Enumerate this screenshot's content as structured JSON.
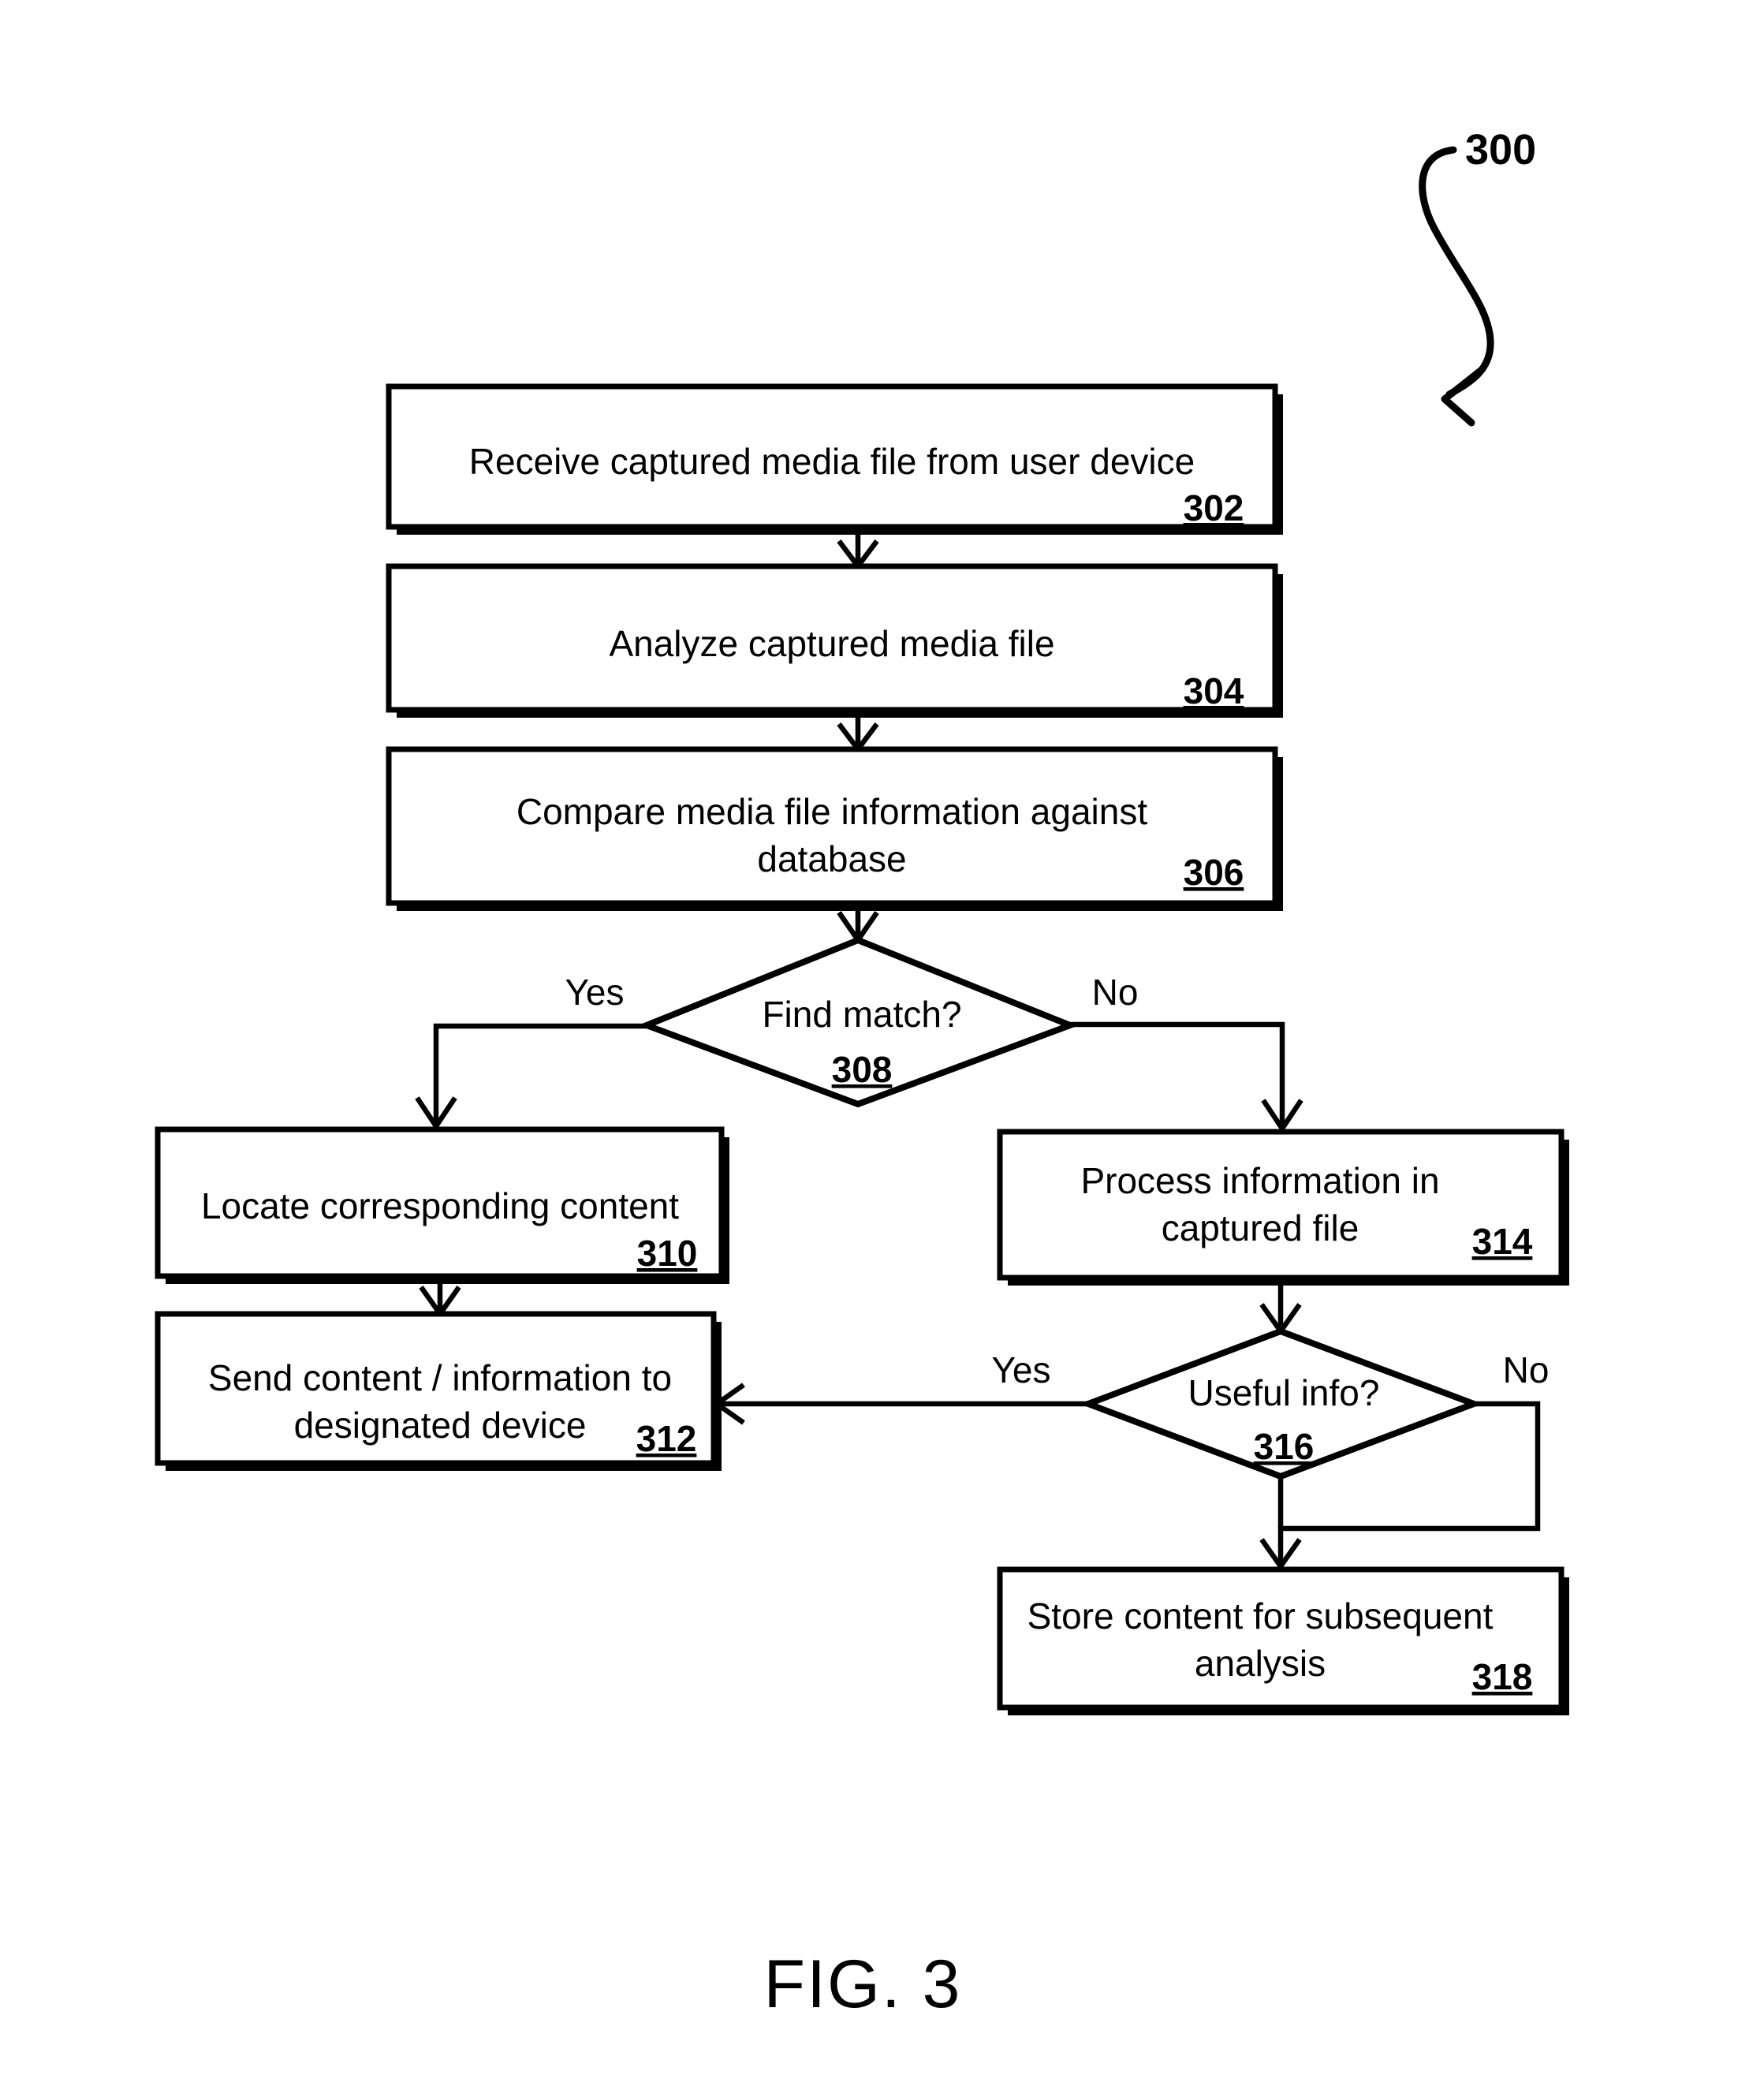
{
  "figure": {
    "caption": "FIG. 3",
    "reference_numeral": "300"
  },
  "diagram": {
    "type": "flowchart",
    "nodes": [
      {
        "id": "302",
        "shape": "process",
        "lines": [
          "Receive captured media file from user device"
        ],
        "ref": "302"
      },
      {
        "id": "304",
        "shape": "process",
        "lines": [
          "Analyze captured media file"
        ],
        "ref": "304"
      },
      {
        "id": "306",
        "shape": "process",
        "lines": [
          "Compare media file information against",
          "database"
        ],
        "ref": "306"
      },
      {
        "id": "308",
        "shape": "decision",
        "lines": [
          "Find match?"
        ],
        "ref": "308"
      },
      {
        "id": "310",
        "shape": "process",
        "lines": [
          "Locate corresponding content"
        ],
        "ref": "310"
      },
      {
        "id": "312",
        "shape": "process",
        "lines": [
          "Send content / information to",
          "designated device"
        ],
        "ref": "312"
      },
      {
        "id": "314",
        "shape": "process",
        "lines": [
          "Process information in",
          "captured file"
        ],
        "ref": "314"
      },
      {
        "id": "316",
        "shape": "decision",
        "lines": [
          "Useful info?"
        ],
        "ref": "316"
      },
      {
        "id": "318",
        "shape": "process",
        "lines": [
          "Store content for subsequent",
          "analysis"
        ],
        "ref": "318"
      }
    ],
    "edges": [
      {
        "from": "302",
        "to": "304",
        "label": ""
      },
      {
        "from": "304",
        "to": "306",
        "label": ""
      },
      {
        "from": "306",
        "to": "308",
        "label": ""
      },
      {
        "from": "308",
        "to": "310",
        "label": "Yes"
      },
      {
        "from": "308",
        "to": "314",
        "label": "No"
      },
      {
        "from": "310",
        "to": "312",
        "label": ""
      },
      {
        "from": "314",
        "to": "316",
        "label": ""
      },
      {
        "from": "316",
        "to": "312",
        "label": "Yes"
      },
      {
        "from": "316",
        "to": "318",
        "label": "No"
      },
      {
        "from": "316",
        "to": "318",
        "label": ""
      }
    ],
    "branch_labels": {
      "d308_yes": "Yes",
      "d308_no": "No",
      "d316_yes": "Yes",
      "d316_no": "No"
    }
  },
  "style": {
    "ink": "#000000",
    "paper": "#ffffff"
  }
}
